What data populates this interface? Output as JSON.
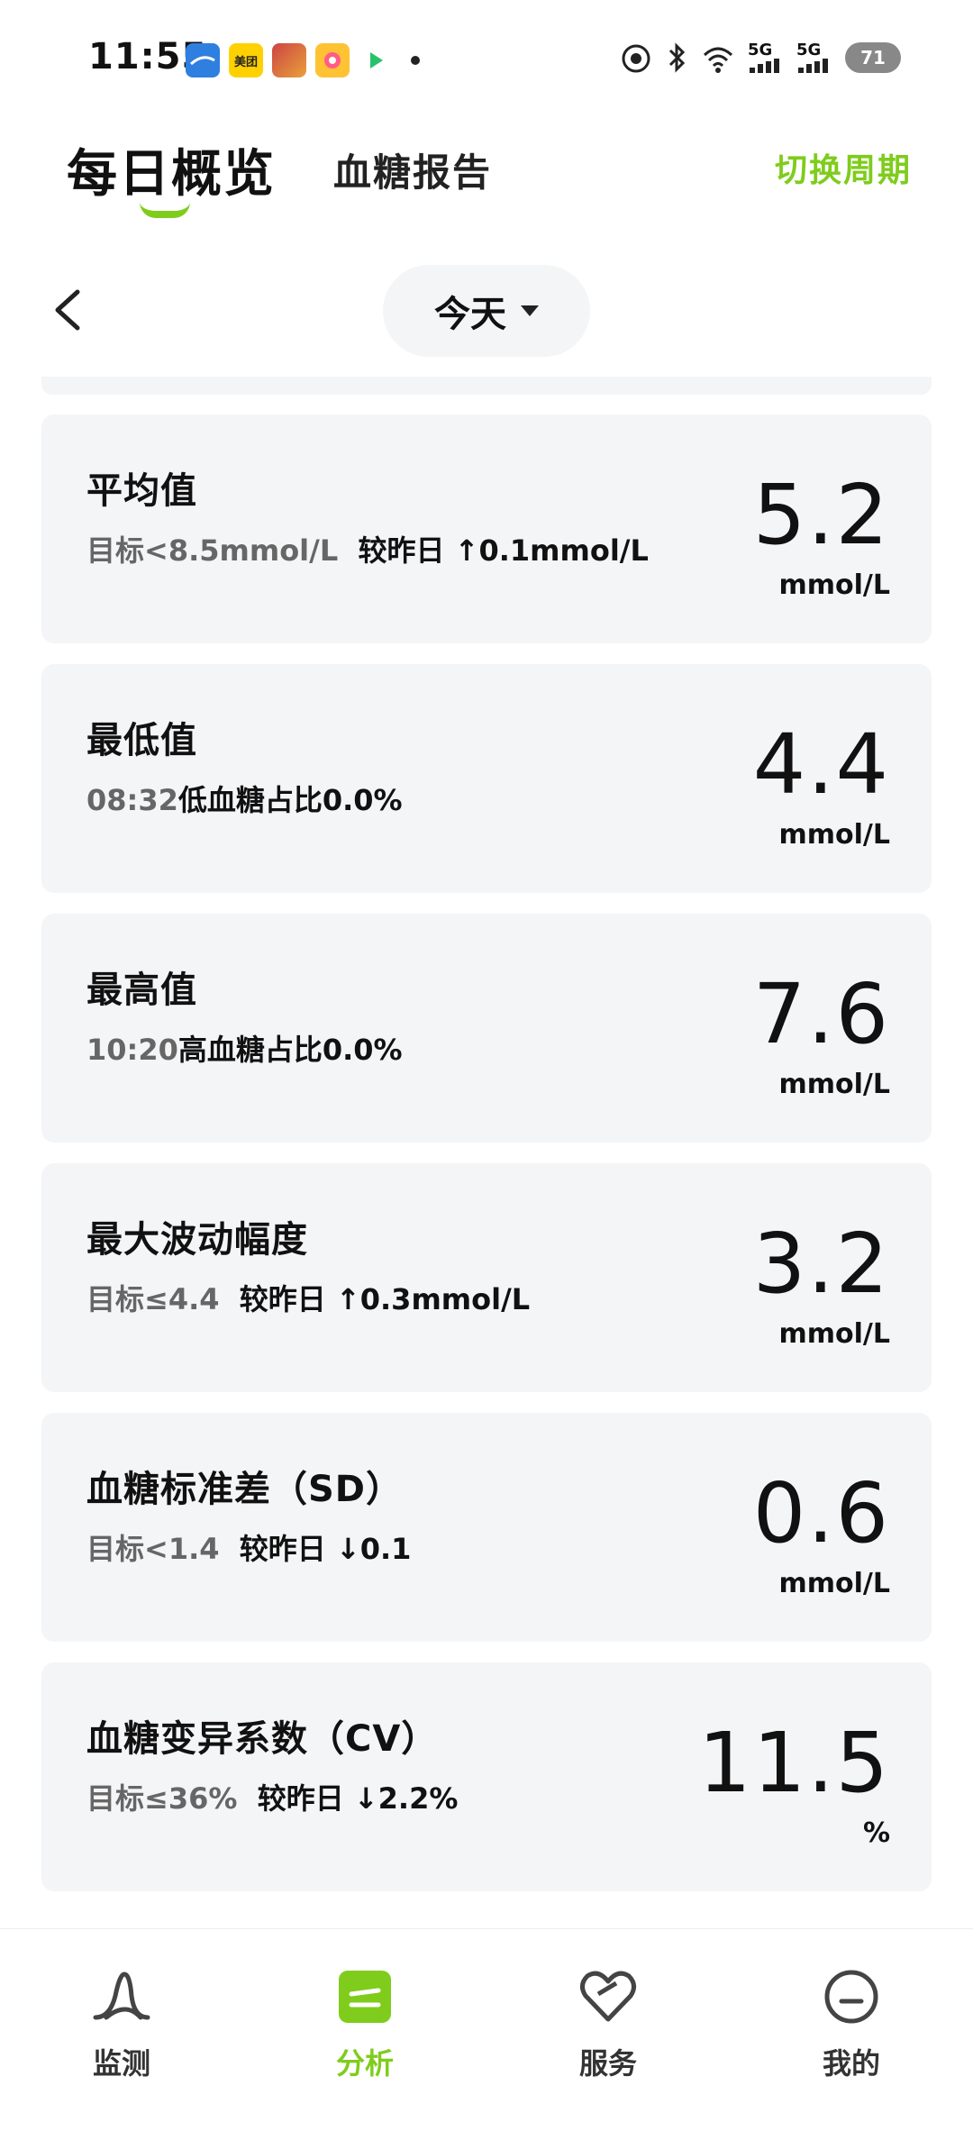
{
  "status_bar": {
    "time": "11:55",
    "app_icons": [
      "transit-app-icon",
      "meituan-app-icon",
      "game-app-icon",
      "flower-app-icon",
      "video-app-icon"
    ],
    "meituan_label": "美团",
    "network_1": "5G",
    "network_2": "5G",
    "battery": "71"
  },
  "header": {
    "tab_daily": "每日概览",
    "tab_report": "血糖报告",
    "switch_period": "切换周期",
    "accent_color": "#7fcc1c"
  },
  "date_selector": {
    "label": "今天"
  },
  "cards": [
    {
      "title": "平均值",
      "sub_muted": "目标<8.5mmol/L",
      "sub_main": "较昨日 ↑0.1mmol/L",
      "value": "5.2",
      "unit": "mmol/L"
    },
    {
      "title": "最低值",
      "sub_muted": "08:32",
      "sub_main": "低血糖占比0.0%",
      "value": "4.4",
      "unit": "mmol/L"
    },
    {
      "title": "最高值",
      "sub_muted": "10:20",
      "sub_main": "高血糖占比0.0%",
      "value": "7.6",
      "unit": "mmol/L"
    },
    {
      "title": "最大波动幅度",
      "sub_muted": "目标≤4.4",
      "sub_main": "较昨日 ↑0.3mmol/L",
      "value": "3.2",
      "unit": "mmol/L"
    },
    {
      "title": "血糖标准差（SD）",
      "sub_muted": "目标<1.4",
      "sub_main": "较昨日 ↓0.1",
      "value": "0.6",
      "unit": "mmol/L"
    },
    {
      "title": "血糖变异系数（CV）",
      "sub_muted": "目标≤36%",
      "sub_main": "较昨日 ↓2.2%",
      "value": "11.5",
      "unit": "%"
    }
  ],
  "bottom_nav": [
    {
      "label": "监测",
      "icon": "monitor-icon",
      "active": false
    },
    {
      "label": "分析",
      "icon": "analysis-icon",
      "active": true
    },
    {
      "label": "服务",
      "icon": "heart-service-icon",
      "active": false
    },
    {
      "label": "我的",
      "icon": "profile-icon",
      "active": false
    }
  ]
}
